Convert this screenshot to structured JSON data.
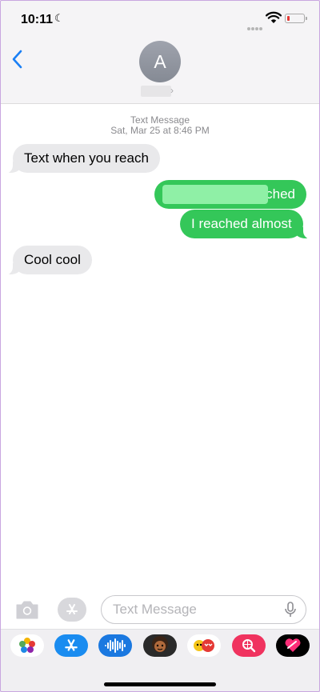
{
  "status_bar": {
    "time": "10:11"
  },
  "contact": {
    "initial": "A"
  },
  "conversation": {
    "meta_line1": "Text Message",
    "meta_line2": "Sat, Mar 25 at 8:46 PM",
    "messages": [
      {
        "direction": "incoming",
        "text": "Text when you reach"
      },
      {
        "direction": "outgoing",
        "text": "ched"
      },
      {
        "direction": "outgoing",
        "text": "I reached almost"
      },
      {
        "direction": "incoming",
        "text": "Cool cool"
      }
    ]
  },
  "input": {
    "placeholder": "Text Message"
  },
  "drawer": {
    "apps": [
      "photos-icon",
      "app-store-icon",
      "audio-message-icon",
      "memoji-icon",
      "animoji-stickers-icon",
      "search-images-icon",
      "digital-touch-icon"
    ]
  },
  "colors": {
    "accent": "#1a7ff5",
    "sms_bubble": "#34c759",
    "incoming_bubble": "#e9e9eb"
  }
}
